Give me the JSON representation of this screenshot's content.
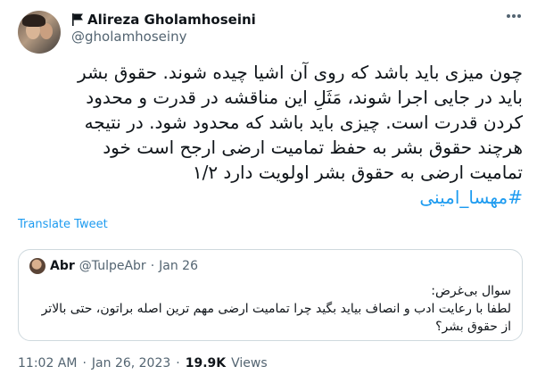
{
  "author": {
    "display_name": "Alireza Gholamhoseini",
    "handle": "@gholamhoseiny",
    "badge_icon": "flag-icon"
  },
  "tweet": {
    "lines": [
      "چون میزی باید باشد که روی آن اشیا چیده شوند. حقوق بشر",
      "باید در جایی اجرا شوند، مَثَلِ این مناقشه در قدرت و محدود",
      "کردن قدرت است. چیزی باید باشد که محدود شود. در نتیجه",
      "هرچند حقوق بشر به حفظ تمامیت ارضی ارجح است خود",
      "تمامیت ارضی به حقوق بشر اولویت دارد ۱/۲"
    ],
    "hashtag": "#مهسا_امینی"
  },
  "translate_label": "Translate Tweet",
  "quote": {
    "display_name": "Abr",
    "handle": "@TulpeAbr",
    "dot": "·",
    "date": "Jan 26",
    "lines": [
      "سوال بی‌غرض:",
      "لطفا با رعایت ادب و انصاف بیاید بگید چرا تمامیت ارضی مهم ترین اصله براتون، حتی بالاتر",
      "از حقوق بشر؟"
    ]
  },
  "meta": {
    "time": "11:02 AM",
    "dot1": "·",
    "date": "Jan 26, 2023",
    "dot2": "·",
    "views_count": "19.9K",
    "views_label": "Views"
  }
}
